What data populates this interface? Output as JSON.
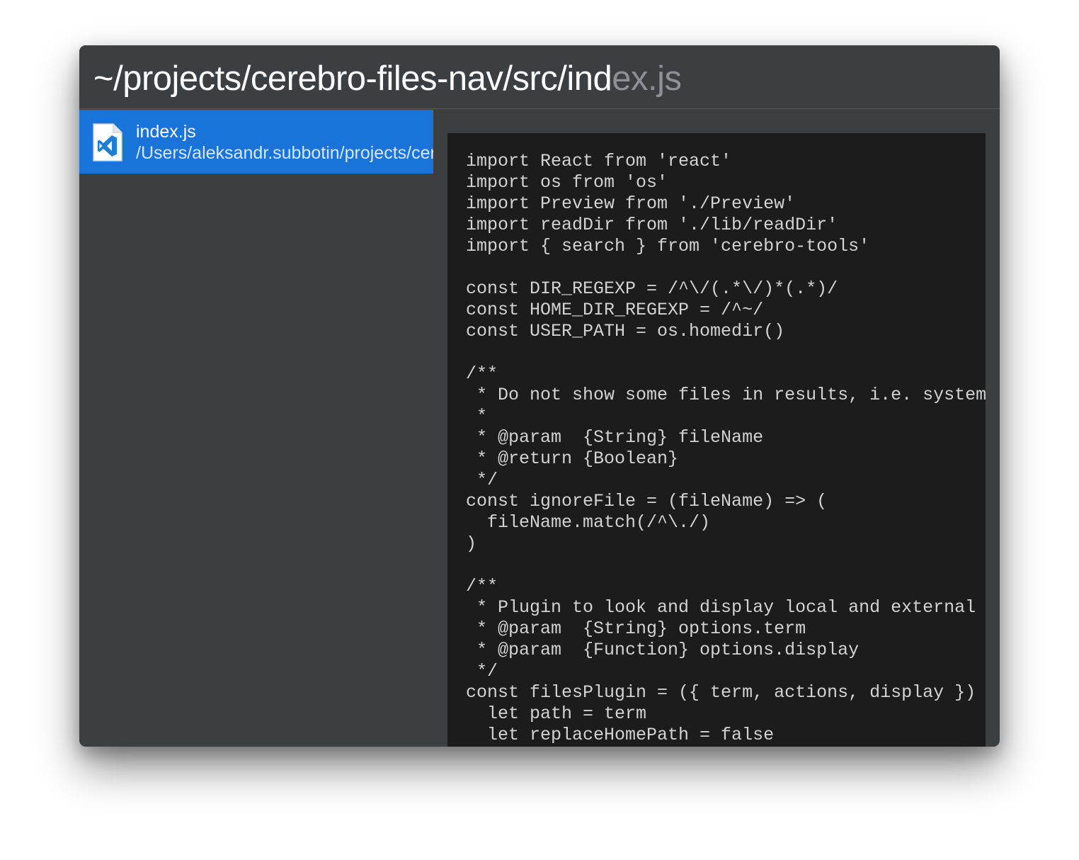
{
  "search": {
    "typed": "~/projects/cerebro-files-nav/src/ind",
    "completion": "ex.js"
  },
  "results": [
    {
      "title": "index.js",
      "subtitle": "/Users/aleksandr.subbotin/projects/cerebro-files-nav/src/index.js",
      "icon": "vscode-file-icon"
    }
  ],
  "preview": {
    "code": "import React from 'react'\nimport os from 'os'\nimport Preview from './Preview'\nimport readDir from './lib/readDir'\nimport { search } from 'cerebro-tools'\n\nconst DIR_REGEXP = /^\\/(.*\\/)*(.*)/\nconst HOME_DIR_REGEXP = /^~/\nconst USER_PATH = os.homedir()\n\n/**\n * Do not show some files in results, i.e. system files\n *\n * @param  {String} fileName\n * @return {Boolean}\n */\nconst ignoreFile = (fileName) => (\n  fileName.match(/^\\./)\n)\n\n/**\n * Plugin to look and display local and external files\n * @param  {String} options.term\n * @param  {Function} options.display\n */\nconst filesPlugin = ({ term, actions, display }) => {\n  let path = term\n  let replaceHomePath = false"
  },
  "colors": {
    "window_bg": "#3c3f42",
    "selected_bg": "#1a73d8",
    "preview_bg": "#1c1c1c",
    "code_text": "#d2d2d2",
    "completion_text": "#8d9094"
  }
}
